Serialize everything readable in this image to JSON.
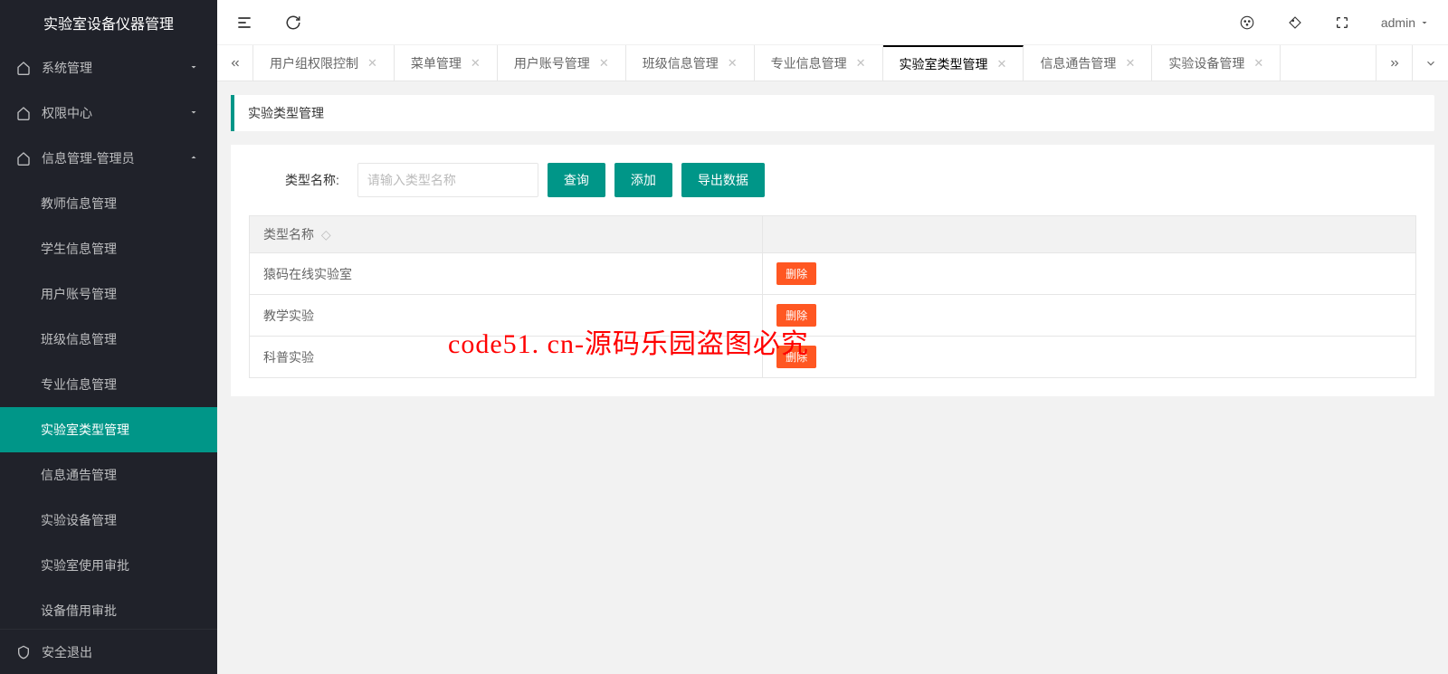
{
  "app": {
    "title": "实验室设备仪器管理"
  },
  "sidebar": {
    "groups": [
      {
        "label": "系统管理",
        "expanded": false
      },
      {
        "label": "权限中心",
        "expanded": false
      },
      {
        "label": "信息管理-管理员",
        "expanded": true
      }
    ],
    "subitems": [
      {
        "label": "教师信息管理",
        "active": false
      },
      {
        "label": "学生信息管理",
        "active": false
      },
      {
        "label": "用户账号管理",
        "active": false
      },
      {
        "label": "班级信息管理",
        "active": false
      },
      {
        "label": "专业信息管理",
        "active": false
      },
      {
        "label": "实验室类型管理",
        "active": true
      },
      {
        "label": "信息通告管理",
        "active": false
      },
      {
        "label": "实验设备管理",
        "active": false
      },
      {
        "label": "实验室使用审批",
        "active": false
      },
      {
        "label": "设备借用审批",
        "active": false
      }
    ],
    "footer": "安全退出"
  },
  "topbar": {
    "user": "admin"
  },
  "tabs": [
    {
      "label": "用户组权限控制",
      "active": false
    },
    {
      "label": "菜单管理",
      "active": false
    },
    {
      "label": "用户账号管理",
      "active": false
    },
    {
      "label": "班级信息管理",
      "active": false
    },
    {
      "label": "专业信息管理",
      "active": false
    },
    {
      "label": "实验室类型管理",
      "active": true
    },
    {
      "label": "信息通告管理",
      "active": false
    },
    {
      "label": "实验设备管理",
      "active": false
    }
  ],
  "page": {
    "title": "实验类型管理",
    "search": {
      "label": "类型名称:",
      "placeholder": "请输入类型名称"
    },
    "buttons": {
      "query": "查询",
      "add": "添加",
      "export": "导出数据"
    },
    "table": {
      "header": "类型名称",
      "delete_label": "删除",
      "rows": [
        {
          "name": "猿码在线实验室"
        },
        {
          "name": "教学实验"
        },
        {
          "name": "科普实验"
        }
      ]
    }
  },
  "watermark": "code51. cn-源码乐园盗图必究"
}
